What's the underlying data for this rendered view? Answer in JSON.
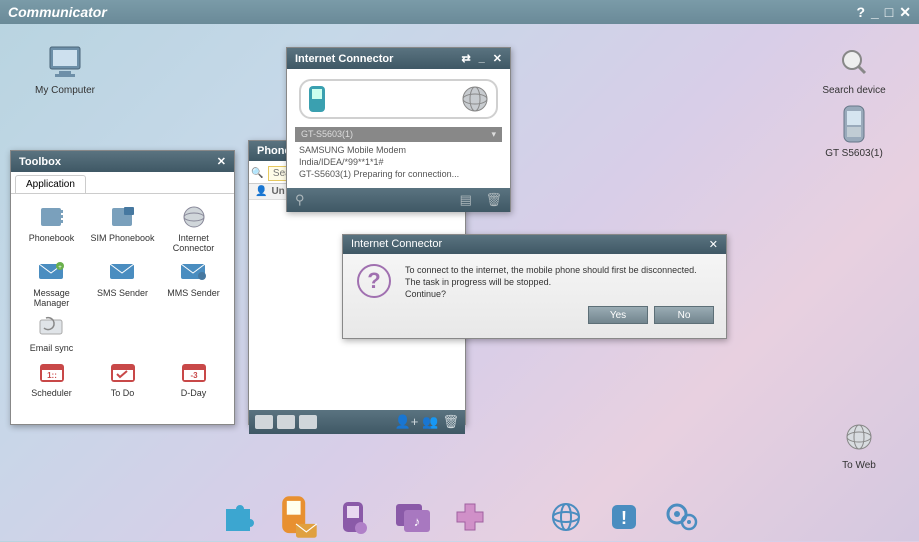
{
  "app": {
    "title": "Communicator"
  },
  "desktop": {
    "my_computer": "My Computer",
    "search_device": "Search device",
    "phone_label": "GT S5603(1)",
    "to_web": "To Web"
  },
  "toolbox": {
    "title": "Toolbox",
    "tab": "Application",
    "items": [
      {
        "label": "Phonebook"
      },
      {
        "label": "SIM Phonebook"
      },
      {
        "label": "Internet Connector"
      },
      {
        "label": "Message Manager"
      },
      {
        "label": "SMS Sender"
      },
      {
        "label": "MMS Sender"
      },
      {
        "label": "Email sync"
      },
      {
        "label": ""
      },
      {
        "label": ""
      },
      {
        "label": "Scheduler"
      },
      {
        "label": "To Do"
      },
      {
        "label": "D-Day"
      }
    ]
  },
  "phonebook": {
    "title": "Phone",
    "search_placeholder": "Sea",
    "header_label": "Un"
  },
  "inet": {
    "title": "Internet Connector",
    "device_row": "GT-S5603(1)",
    "line1": "SAMSUNG Mobile Modem",
    "line2": "India/IDEA/*99**1*1#",
    "line3": "GT-S5603(1) Preparing for connection..."
  },
  "dialog": {
    "title": "Internet Connector",
    "line1": "To connect to the internet, the mobile phone should first be disconnected.",
    "line2": "The task in progress will be stopped.",
    "line3": "Continue?",
    "yes": "Yes",
    "no": "No"
  }
}
